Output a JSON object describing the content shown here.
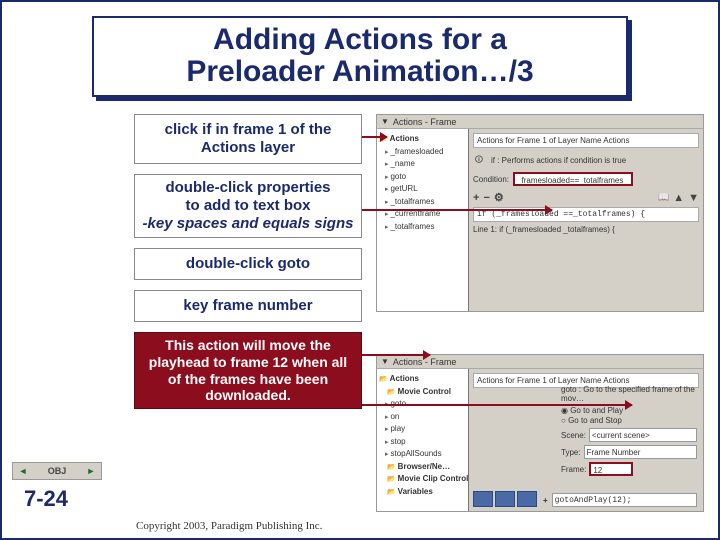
{
  "title": {
    "line1": "Adding Actions for a",
    "line2": "Preloader Animation…/3"
  },
  "boxes": {
    "b1": "click if in frame 1 of the Actions layer",
    "b2_l1": "double-click properties",
    "b2_l2": "to add to text box",
    "b2_l3": "-key spaces and equals signs",
    "b3": "double-click goto",
    "b4": "key frame number",
    "result": "This action will move the playhead to frame 12 when all of the frames have been downloaded."
  },
  "ss1": {
    "panel_title": "Actions - Frame",
    "toolbar": "Actions for Frame 1 of Layer Name Actions",
    "hint": "if : Performs actions if condition is true",
    "cond_label": "Condition:",
    "cond_value": "_framesloaded==_totalframes",
    "tree": {
      "cat": "Actions",
      "items": [
        "_framesloaded",
        "_name",
        "goto",
        "getURL",
        "_totalframes",
        "_currentframe",
        "_totalframes"
      ]
    },
    "code": "if (_framesloaded ==_totalframes) {",
    "status": "Line 1:  if (_framesloaded    _totalframes) {"
  },
  "ss2": {
    "panel_title": "Actions - Frame",
    "toolbar": "Actions for Frame 1 of Layer Name Actions",
    "goto_hint": "goto : Go to the specified frame of the mov…",
    "radio1": "Go to and Play",
    "radio2": "Go to and Stop",
    "scene_label": "Scene:",
    "scene_value": "<current scene>",
    "type_label": "Type:",
    "type_value": "Frame Number",
    "frame_label": "Frame:",
    "frame_value": "12",
    "tree": {
      "cat": "Actions",
      "sub": "Movie Control",
      "items": [
        "goto",
        "on",
        "play",
        "stop",
        "stopAllSounds"
      ],
      "sub2": "Browser/Ne…",
      "sub3": "Movie Clip Control",
      "sub4": "Variables"
    },
    "goto_code": "gotoAndPlay(12);"
  },
  "nav": {
    "obj": "OBJ",
    "page": "7-24"
  },
  "copyright": "Copyright 2003, Paradigm Publishing Inc."
}
